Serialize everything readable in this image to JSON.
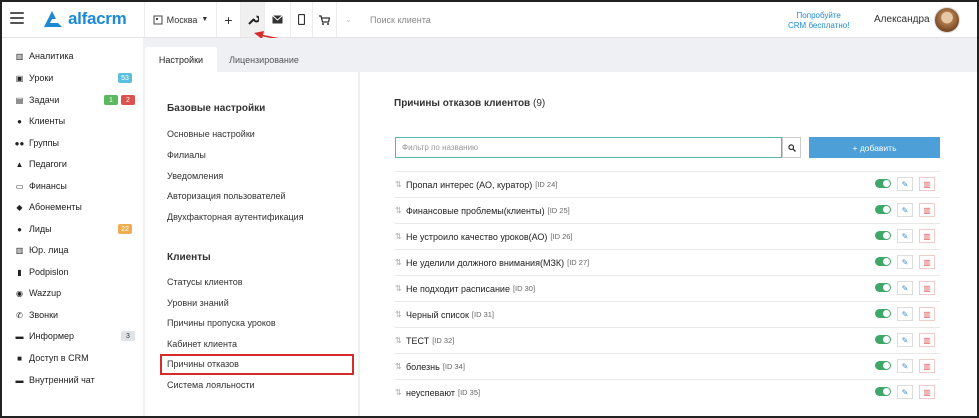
{
  "header": {
    "logo_text": "alfacrm",
    "branch": "Москва",
    "search_placeholder": "Поиск клиента",
    "promo_line1": "Попробуйте",
    "promo_line2": "CRM бесплатно!",
    "user_name": "Александра"
  },
  "sidebar": {
    "items": [
      {
        "label": "Аналитика",
        "icon": "chart-icon"
      },
      {
        "label": "Уроки",
        "icon": "calendar-icon",
        "badges": [
          "53"
        ]
      },
      {
        "label": "Задачи",
        "icon": "tasks-icon",
        "badges": [
          "1",
          "2"
        ]
      },
      {
        "label": "Клиенты",
        "icon": "user-icon"
      },
      {
        "label": "Группы",
        "icon": "users-icon"
      },
      {
        "label": "Педагоги",
        "icon": "graduation-cap-icon"
      },
      {
        "label": "Финансы",
        "icon": "money-icon"
      },
      {
        "label": "Абонементы",
        "icon": "tag-icon"
      },
      {
        "label": "Лиды",
        "icon": "user-plus-icon",
        "badges": [
          "22"
        ]
      },
      {
        "label": "Юр. лица",
        "icon": "building-icon"
      },
      {
        "label": "Podpislon",
        "icon": "document-icon"
      },
      {
        "label": "Wazzup",
        "icon": "whatsapp-icon"
      },
      {
        "label": "Звонки",
        "icon": "phone-icon"
      },
      {
        "label": "Информер",
        "icon": "informer-icon",
        "badges": [
          "3"
        ]
      },
      {
        "label": "Доступ в CRM",
        "icon": "lock-icon"
      },
      {
        "label": "Внутренний чат",
        "icon": "chat-icon"
      }
    ]
  },
  "tabs": [
    {
      "label": "Настройки",
      "active": true
    },
    {
      "label": "Лицензирование",
      "active": false
    }
  ],
  "settings_menu": {
    "basic_title": "Базовые настройки",
    "basic_items": [
      "Основные настройки",
      "Филиалы",
      "Уведомления",
      "Авторизация пользователей",
      "Двухфакторная аутентификация"
    ],
    "clients_title": "Клиенты",
    "clients_items": [
      "Статусы клиентов",
      "Уровни знаний",
      "Причины пропуска уроков",
      "Кабинет клиента",
      "Причины отказов",
      "Система лояльности"
    ]
  },
  "content": {
    "title": "Причины отказов клиентов",
    "count": "(9)",
    "filter_placeholder": "Фильтр по названию",
    "add_label": "+ добавить",
    "reasons": [
      {
        "name": "Пропал интерес (АО, куратор)",
        "id": "[ID 24]"
      },
      {
        "name": "Финансовые проблемы(клиенты)",
        "id": "[ID 25]"
      },
      {
        "name": "Не устроило качество уроков(АО)",
        "id": "[ID 26]"
      },
      {
        "name": "Не уделили должного внимания(МЗК)",
        "id": "[ID 27]"
      },
      {
        "name": "Не подходит расписание",
        "id": "[ID 30]"
      },
      {
        "name": "Черный список",
        "id": "[ID 31]"
      },
      {
        "name": "ТЕСТ",
        "id": "[ID 32]"
      },
      {
        "name": "болезнь",
        "id": "[ID 34]"
      },
      {
        "name": "неуспевают",
        "id": "[ID 35]"
      }
    ]
  },
  "colors": {
    "accent": "#1c8ad4",
    "add_button": "#4d9fd8",
    "toggle_on": "#3ea76a",
    "highlight": "#d62b2b"
  }
}
